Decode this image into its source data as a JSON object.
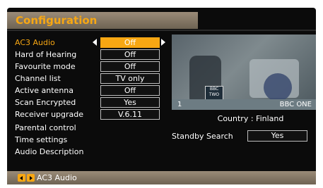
{
  "menu": {
    "title": "Configuration",
    "items": [
      {
        "label": "AC3 Audio",
        "value": "Off",
        "selected": true
      },
      {
        "label": "Hard of Hearing",
        "value": "Off"
      },
      {
        "label": "Favourite mode",
        "value": "Off"
      },
      {
        "label": "Channel list",
        "value": "TV only"
      },
      {
        "label": "Active antenna",
        "value": "Off"
      },
      {
        "label": "Scan Encrypted",
        "value": "Yes"
      },
      {
        "label": "Receiver upgrade",
        "value": "V.6.11"
      },
      {
        "label": "Parental control"
      },
      {
        "label": "Time settings"
      },
      {
        "label": "Audio Description"
      }
    ]
  },
  "preview": {
    "channel_number": "1",
    "channel_name": "BBC ONE",
    "logo_text": "BBC TWO"
  },
  "country": "Country : Finland",
  "standby": {
    "label": "Standby Search",
    "value": "Yes"
  },
  "footer": {
    "hint": "AC3 Audio",
    "icons": [
      "left-arrow-key-icon",
      "right-arrow-key-icon"
    ]
  },
  "colors": {
    "accent": "#f7a713",
    "panel": "#0b0b0b",
    "bar": "#8a7b69"
  }
}
